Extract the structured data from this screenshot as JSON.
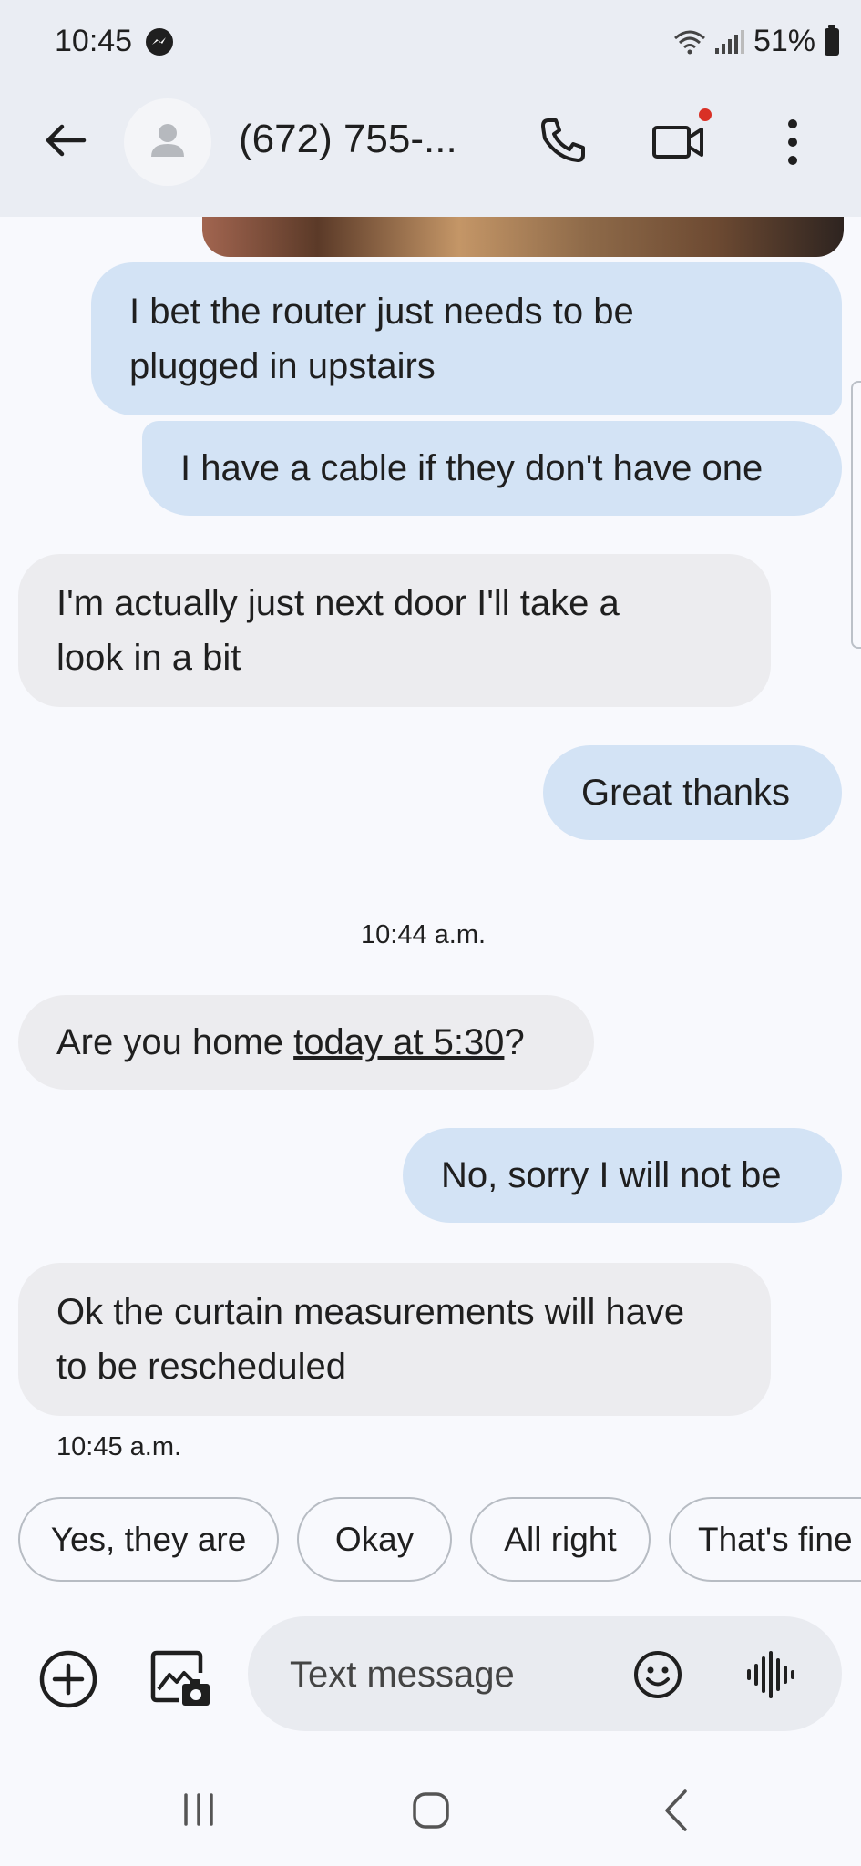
{
  "status_bar": {
    "time": "10:45",
    "battery": "51%"
  },
  "app_bar": {
    "contact_name": "(672) 755-..."
  },
  "messages": [
    {
      "direction": "out",
      "lines": [
        "I bet the router just needs to be",
        "plugged in upstairs"
      ]
    },
    {
      "direction": "out",
      "lines": [
        "I have a cable if they don't have one"
      ]
    },
    {
      "direction": "in",
      "lines": [
        "I'm actually just next door I'll take a",
        "look in a bit"
      ]
    },
    {
      "direction": "out",
      "lines": [
        "Great thanks"
      ]
    },
    {
      "direction": "in",
      "text_before": "Are you home ",
      "link": "today at 5:30",
      "text_after": "?"
    },
    {
      "direction": "out",
      "lines": [
        "No, sorry I will not be"
      ]
    },
    {
      "direction": "in",
      "lines": [
        "Ok the curtain measurements will have",
        "to be rescheduled"
      ]
    }
  ],
  "timestamps": {
    "divider": "10:44 a.m.",
    "last_message": "10:45 a.m."
  },
  "smart_replies": [
    "Yes, they are",
    "Okay",
    "All right",
    "That's fine"
  ],
  "composer": {
    "placeholder": "Text message"
  },
  "colors": {
    "outgoing_bubble": "#d3e3f5",
    "incoming_bubble": "#ececef",
    "app_bar": "#eaedf3",
    "notification_dot": "#d93025"
  },
  "icons": {
    "back": "arrow-left-icon",
    "call": "phone-icon",
    "video": "video-camera-icon",
    "more": "more-vert-icon",
    "add": "add-circle-icon",
    "gallery": "gallery-icon",
    "emoji": "emoji-icon",
    "voice": "voice-waveform-icon"
  }
}
